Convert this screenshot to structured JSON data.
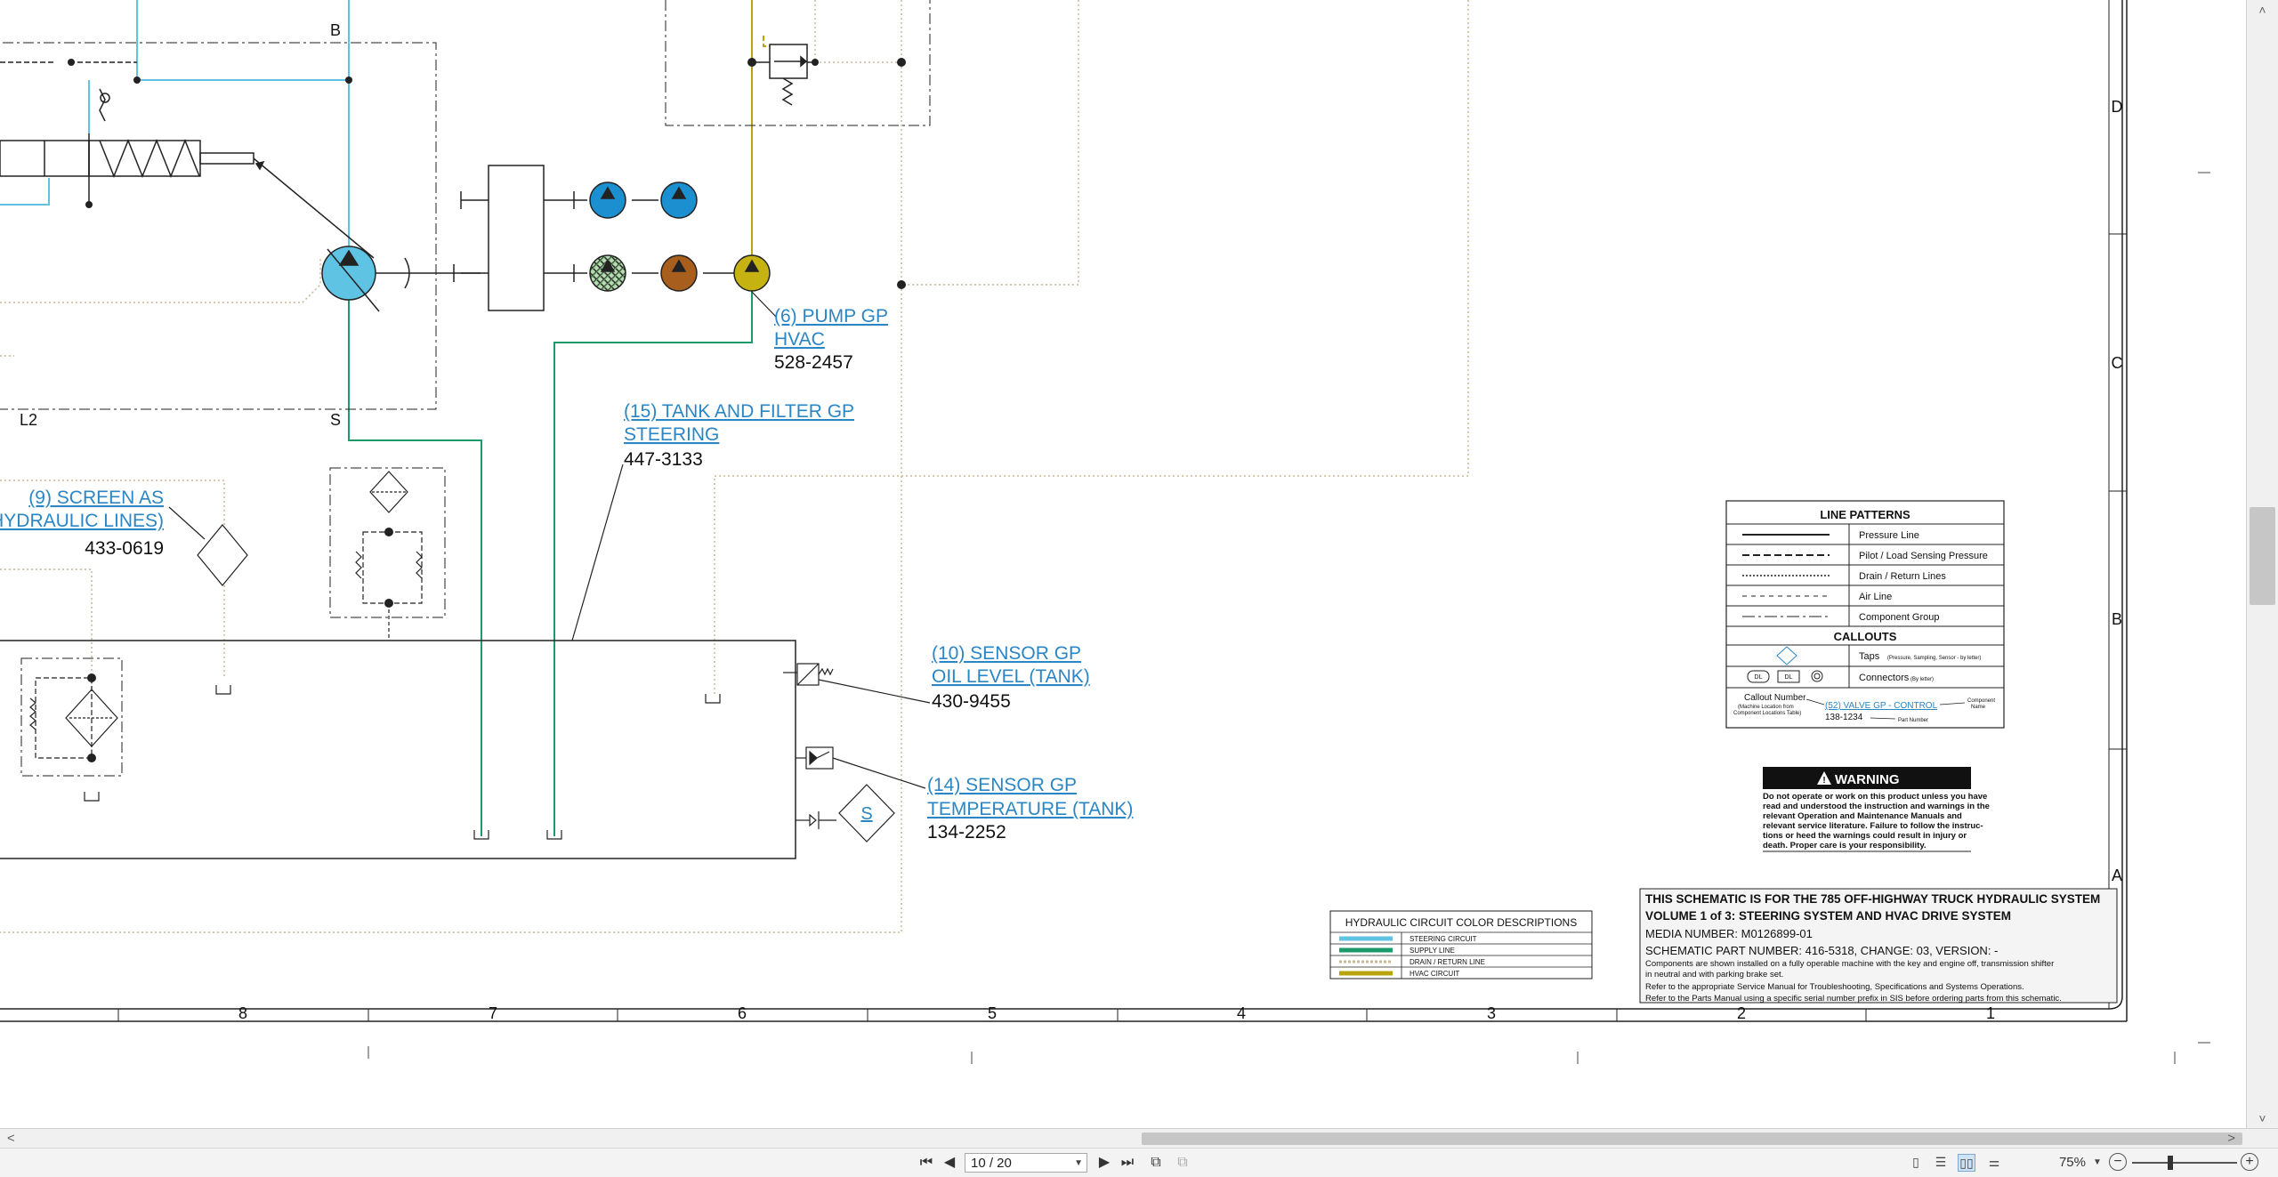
{
  "colors": {
    "steering": "#5fc3e4",
    "supply": "#1c9a6c",
    "drain": "#c8b896",
    "hvac": "#b9a410",
    "pump_blue": "#1b8fcf",
    "pump_brown": "#a85e1c",
    "pump_yellow": "#c6b312",
    "link": "#2a86c4"
  },
  "zone_letters": [
    "D",
    "C",
    "B",
    "A"
  ],
  "column_numbers": [
    "8",
    "7",
    "6",
    "5",
    "4",
    "3",
    "2",
    "1"
  ],
  "port_labels": {
    "b": "B",
    "l2": "L2",
    "s": "S"
  },
  "callouts": {
    "pump_hvac": {
      "line1": "(6) PUMP GP",
      "line2": "HVAC",
      "part": "528-2457"
    },
    "tank_filter": {
      "line1": "(15) TANK AND FILTER GP",
      "line2": "STEERING",
      "part": "447-3133"
    },
    "screen": {
      "line1": "(9) SCREEN AS",
      "line2": "(HYDRAULIC LINES)",
      "part": "433-0619"
    },
    "oil_level": {
      "line1": "(10) SENSOR GP",
      "line2": "OIL LEVEL (TANK)",
      "part": "430-9455"
    },
    "temperature": {
      "line1": "(14) SENSOR GP",
      "line2": "TEMPERATURE (TANK)",
      "part": "134-2252"
    },
    "sensor_symbol": "S"
  },
  "line_patterns": {
    "title": "LINE PATTERNS",
    "rows": [
      "Pressure Line",
      "Pilot / Load Sensing Pressure",
      "Drain / Return Lines",
      "Air Line",
      "Component Group"
    ],
    "callouts_title": "CALLOUTS",
    "taps_label": "Taps",
    "taps_note": "(Pressure, Sampling, Sensor - by letter)",
    "connectors_label": "Connectors",
    "connectors_note": "(By letter)",
    "connector_marks": [
      "DL",
      "DL"
    ],
    "callout_number_label": "Callout Number",
    "callout_number_note1": "(Machine Location from",
    "callout_number_note2": "Component Locations Table)",
    "example_link": "(52) VALVE GP - CONTROL",
    "example_part": "138-1234",
    "component_name_label1": "Component",
    "component_name_label2": "Name",
    "part_number_label": "Part Number"
  },
  "warning": {
    "title": "WARNING",
    "lines": [
      "Do not operate or work on this product unless you have",
      "read and understood the instruction and warnings in the",
      "relevant Operation and Maintenance Manuals and",
      "relevant service literature. Failure to follow the instruc-",
      "tions or heed the warnings could result in injury or",
      "death. Proper care is your responsibility."
    ]
  },
  "color_desc": {
    "title": "HYDRAULIC CIRCUIT COLOR DESCRIPTIONS",
    "rows": [
      "STEERING CIRCUIT",
      "SUPPLY LINE",
      "DRAIN / RETURN LINE",
      "HVAC CIRCUIT"
    ]
  },
  "title_block": {
    "line1": "THIS SCHEMATIC IS FOR THE 785 OFF-HIGHWAY TRUCK HYDRAULIC SYSTEM",
    "line2": "VOLUME 1 of 3: STEERING SYSTEM AND HVAC DRIVE SYSTEM",
    "media": "MEDIA NUMBER: M0126899-01",
    "part": "SCHEMATIC PART NUMBER: 416-5318, CHANGE: 03, VERSION: -",
    "note1": "Components are shown installed on a fully operable machine with the key and engine off, transmission shifter",
    "note2": "in neutral and with parking brake set.",
    "note3": "Refer to the appropriate Service Manual for Troubleshooting, Specifications and Systems Operations.",
    "note4": "Refer to the Parts Manual using a specific serial number prefix in SIS before ordering parts from this schematic."
  },
  "toolbar": {
    "page_value": "10 / 20",
    "zoom": "75%",
    "first_page_icon": "first-page-icon",
    "prev_page_icon": "previous-page-icon",
    "next_page_icon": "next-page-icon",
    "last_page_icon": "last-page-icon"
  }
}
